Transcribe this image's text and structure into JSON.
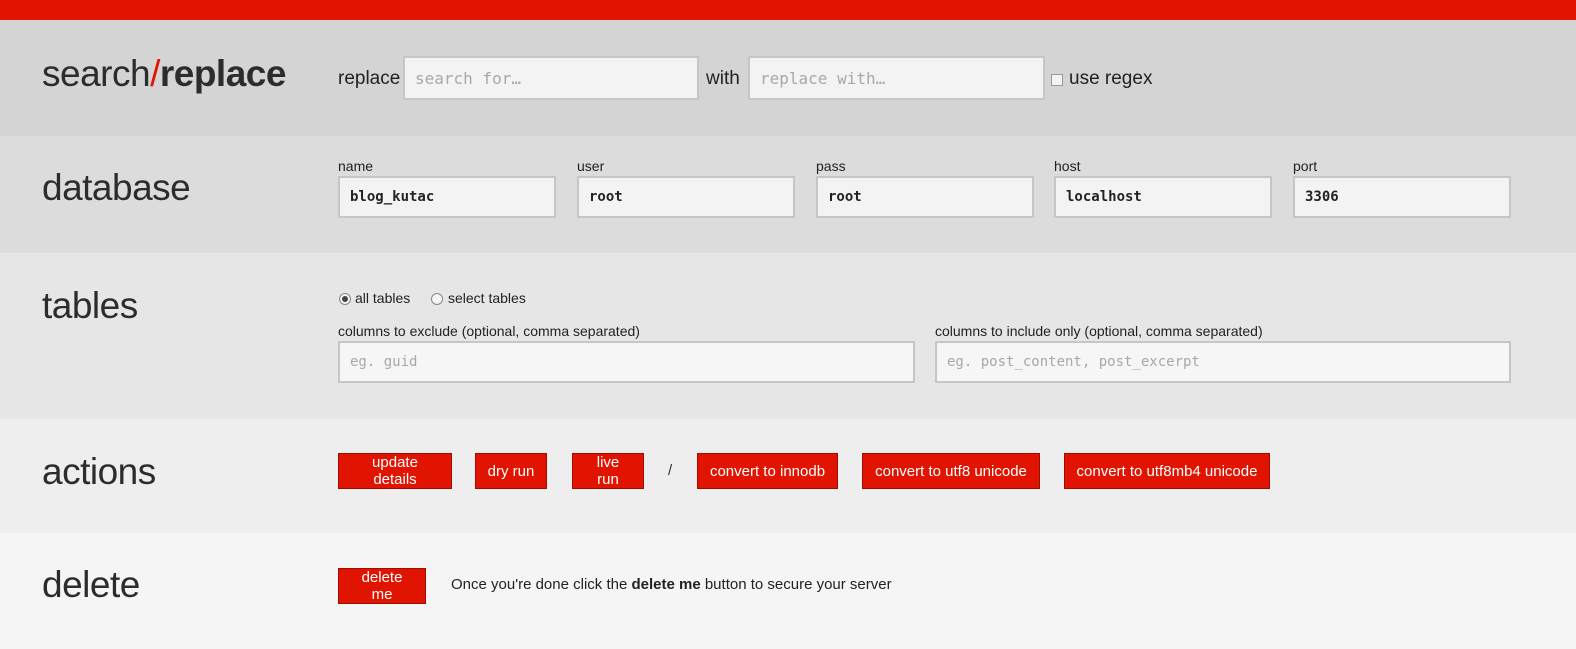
{
  "colors": {
    "accent": "#e01400"
  },
  "search": {
    "title_left": "search",
    "title_slash": "/",
    "title_right": "replace",
    "replace_label": "replace",
    "search_placeholder": "search for…",
    "with_label": "with",
    "replace_placeholder": "replace with…",
    "regex_label": "use regex"
  },
  "database": {
    "title": "database",
    "fields": [
      {
        "label": "name",
        "value": "blog_kutac"
      },
      {
        "label": "user",
        "value": "root"
      },
      {
        "label": "pass",
        "value": "root"
      },
      {
        "label": "host",
        "value": "localhost"
      },
      {
        "label": "port",
        "value": "3306"
      }
    ]
  },
  "tables": {
    "title": "tables",
    "all_tables_label": "all tables",
    "select_tables_label": "select tables",
    "exclude_label": "columns to exclude (optional, comma separated)",
    "exclude_placeholder": "eg. guid",
    "include_label": "columns to include only (optional, comma separated)",
    "include_placeholder": "eg. post_content, post_excerpt"
  },
  "actions": {
    "title": "actions",
    "update_details": "update details",
    "dry_run": "dry run",
    "live_run": "live run",
    "separator": "/",
    "convert_innodb": "convert to innodb",
    "convert_utf8": "convert to utf8 unicode",
    "convert_utf8mb4": "convert to utf8mb4 unicode"
  },
  "delete": {
    "title": "delete",
    "button": "delete me",
    "note_before": "Once you're done click the",
    "note_bold": "delete me",
    "note_after": "button to secure your server"
  }
}
